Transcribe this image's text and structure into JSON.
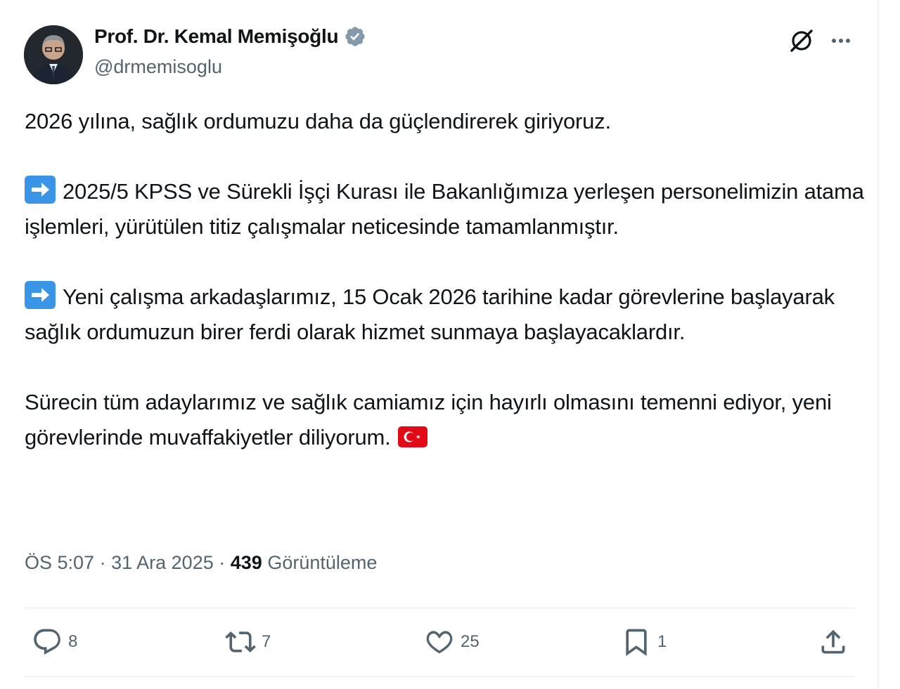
{
  "author": {
    "name": "Prof. Dr. Kemal Memişoğlu",
    "handle": "@drmemisoglu",
    "verified": true,
    "verified_color": "#829aab"
  },
  "header_icons": [
    "grok-icon",
    "more-icon"
  ],
  "tweet": {
    "paragraph_1": "2026 yılına, sağlık ordumuzu daha da güçlendirerek giriyoruz.",
    "paragraph_2": "2025/5 KPSS ve Sürekli İşçi Kurası ile Bakanlığımıza yerleşen personelimizin atama işlemleri, yürütülen titiz çalışmalar neticesinde tamamlanmıştır.",
    "paragraph_3": "Yeni çalışma arkadaşlarımız, 15 Ocak 2026 tarihine kadar görevlerine başlayarak sağlık ordumuzun birer ferdi olarak hizmet sunmaya başlayacaklardır.",
    "paragraph_4": "Sürecin tüm adaylarımız ve sağlık camiamız için hayırlı olmasını temenni ediyor, yeni görevlerinde muvaffakiyetler diliyorum.",
    "emojis": [
      "right-arrow-emoji",
      "turkey-flag-emoji"
    ]
  },
  "meta": {
    "time": "ÖS 5:07",
    "separator": "·",
    "date": "31 Ara 2025",
    "views_count": "439",
    "views_label": "Görüntüleme"
  },
  "actions": {
    "replies": "8",
    "reposts": "7",
    "likes": "25",
    "bookmarks": "1"
  },
  "colors": {
    "text": "#0f1419",
    "secondary": "#536471",
    "divider": "#e7ebee",
    "emoji_blue": "#3b95e6",
    "flag_red": "#e30a17"
  }
}
